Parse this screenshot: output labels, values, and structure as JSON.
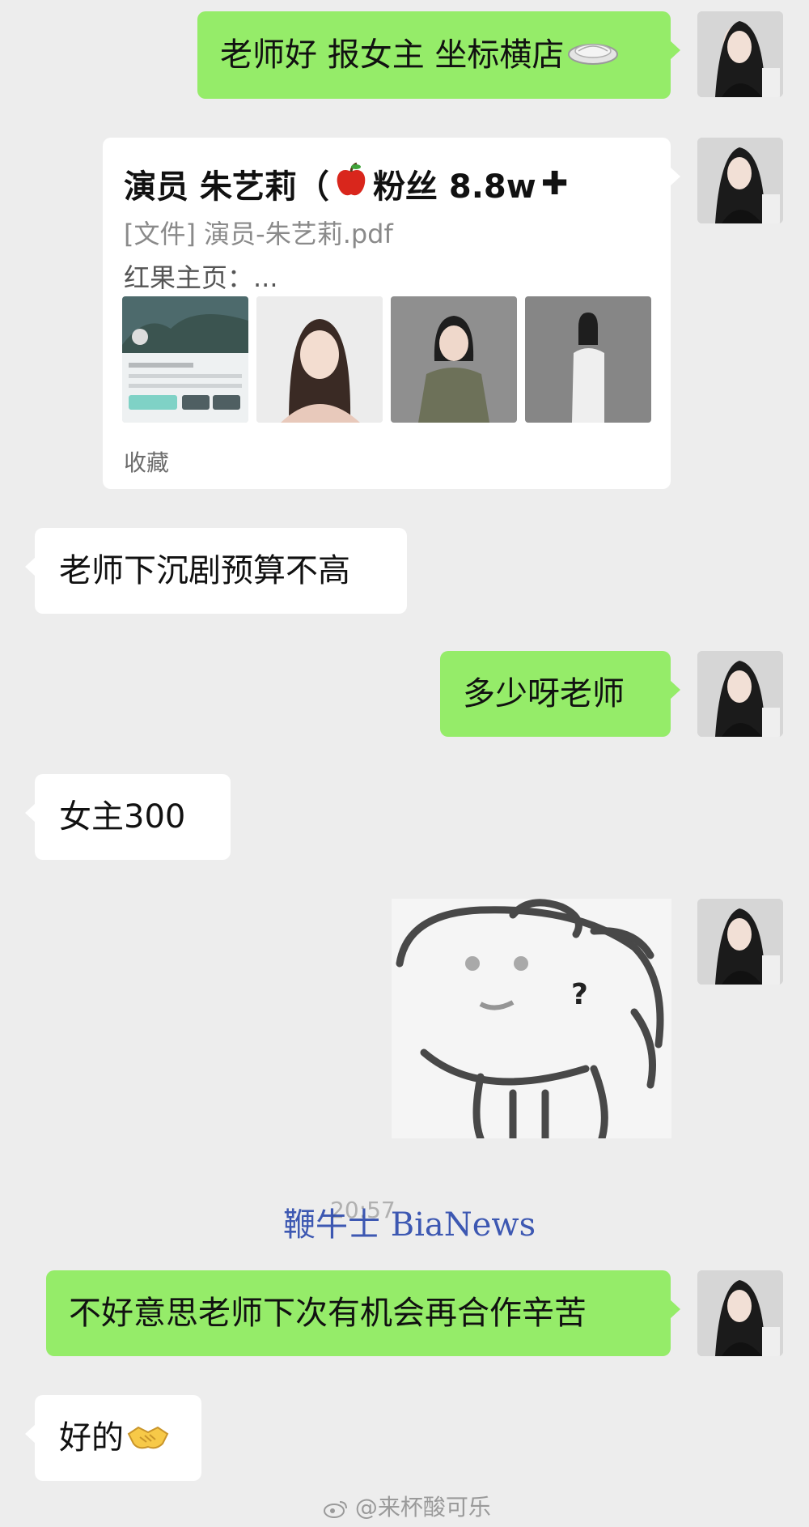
{
  "messages": [
    {
      "side": "right",
      "text": "老师好 报女主 坐标横店",
      "emoji": "dish-icon"
    },
    {
      "side": "right",
      "type": "card",
      "title": "演员 朱艺莉（",
      "title_suffix": "粉丝 8.8w",
      "title_plus": "✚",
      "file_line": "[文件] 演员-朱艺莉.pdf",
      "link_line": "红果主页：...",
      "footer": "收藏"
    },
    {
      "side": "left",
      "text": "老师下沉剧预算不高"
    },
    {
      "side": "right",
      "text": "多少呀老师"
    },
    {
      "side": "left",
      "text": "女主300"
    },
    {
      "side": "right",
      "type": "sticker",
      "mark": "?"
    },
    {
      "side": "right",
      "text": "不好意思老师下次有机会再合作辛苦"
    },
    {
      "side": "left",
      "text": "好的",
      "emoji": "handshake-icon"
    }
  ],
  "timestamp": "20:57",
  "watermark": "鞭牛士 BiaNews",
  "credit": "@来杯酸可乐",
  "colors": {
    "background": "#ededed",
    "sent_bubble": "#95ec69",
    "received_bubble": "#ffffff"
  }
}
